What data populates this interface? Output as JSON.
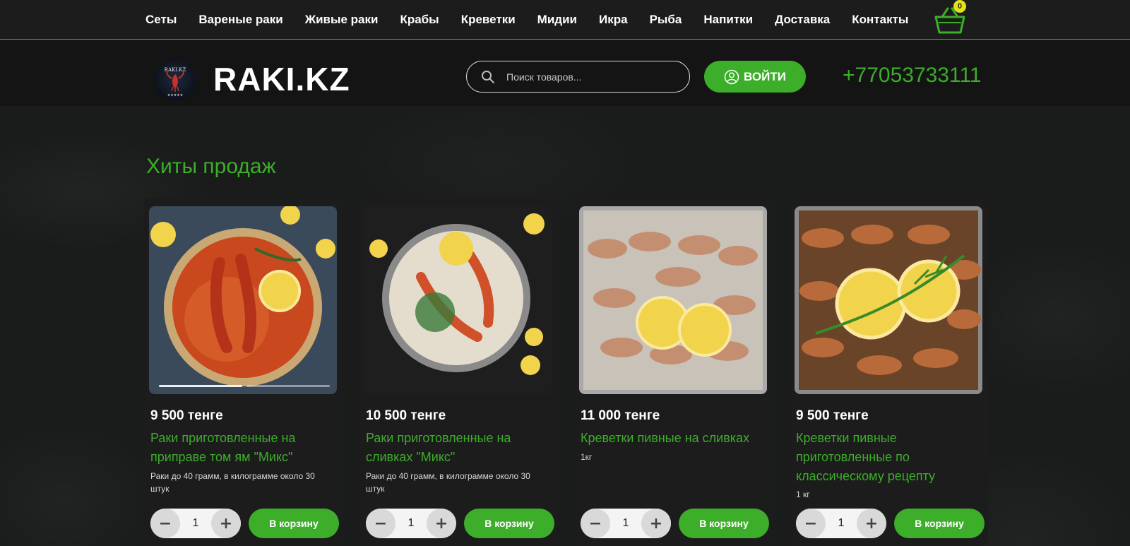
{
  "nav": {
    "items": [
      "Сеты",
      "Вареные раки",
      "Живые раки",
      "Крабы",
      "Креветки",
      "Мидии",
      "Икра",
      "Рыба",
      "Напитки",
      "Доставка",
      "Контакты"
    ],
    "cart_count": "0"
  },
  "header": {
    "logo_badge": "RAKI.KZ",
    "logo_text": "RAKI.KZ",
    "search_placeholder": "Поиск товаров...",
    "login_label": "ВОЙТИ",
    "phone": "+77053733111"
  },
  "section": {
    "title": "Хиты продаж"
  },
  "products": [
    {
      "price": "9 500 тенге",
      "title": "Раки приготовленные на приправе том ям \"Микс\"",
      "desc": "Раки до 40 грамм, в килограмме около 30 штук",
      "qty": "1",
      "add_label": "В корзину"
    },
    {
      "price": "10 500 тенге",
      "title": "Раки приготовленные на сливках \"Микс\"",
      "desc": "Раки до 40 грамм, в килограмме около 30 штук",
      "qty": "1",
      "add_label": "В корзину"
    },
    {
      "price": "11 000 тенге",
      "title": "Креветки пивные на сливках",
      "desc": "1кг",
      "qty": "1",
      "add_label": "В корзину"
    },
    {
      "price": "9 500 тенге",
      "title": "Креветки пивные приготовленные по классическому рецепту",
      "desc": "1 кг",
      "qty": "1",
      "add_label": "В корзину"
    }
  ],
  "colors": {
    "accent": "#3cae2a",
    "badge": "#e6e218",
    "background": "#161817"
  }
}
